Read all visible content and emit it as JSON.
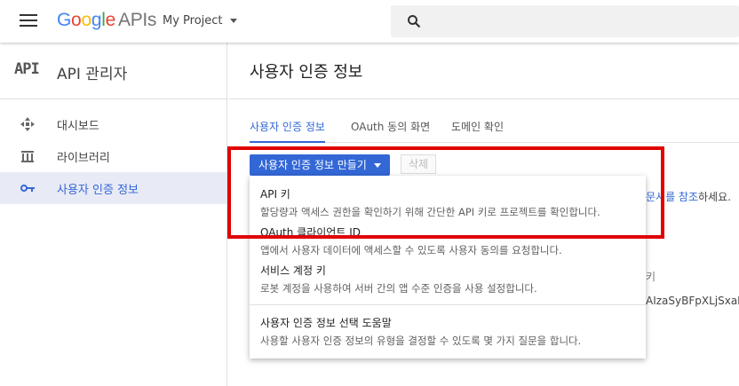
{
  "header": {
    "logo_letters": [
      "G",
      "o",
      "o",
      "g",
      "l",
      "e"
    ],
    "logo_suffix": "APIs",
    "project": "My Project",
    "colors": {
      "blue": "#4285f4",
      "red": "#ea4335",
      "yellow": "#fbbc05",
      "green": "#34a853"
    }
  },
  "sidebar": {
    "brand_mark": "API",
    "title": "API 관리자",
    "items": [
      {
        "label": "대시보드",
        "icon": "dashboard-icon",
        "active": false
      },
      {
        "label": "라이브러리",
        "icon": "library-icon",
        "active": false
      },
      {
        "label": "사용자 인증 정보",
        "icon": "key-icon",
        "active": true
      }
    ]
  },
  "main": {
    "title": "사용자 인증 정보",
    "tabs": [
      {
        "label": "사용자 인증 정보",
        "active": true
      },
      {
        "label": "OAuth 동의 화면",
        "active": false
      },
      {
        "label": "도메인 확인",
        "active": false
      }
    ],
    "create_button": "사용자 인증 정보 만들기",
    "delete_button": "삭제",
    "background": {
      "doc_link": "문서를 참조",
      "doc_suffix": "하세요.",
      "key_column_fragment": "키",
      "key_value_fragment": "AIzaSyBFpXLjSxaMC"
    }
  },
  "menu": {
    "items": [
      {
        "title": "API 키",
        "desc": "할당량과 액세스 권한을 확인하기 위해 간단한 API 키로 프로젝트를 확인합니다."
      },
      {
        "title": "OAuth 클라이언트 ID",
        "desc": "앱에서 사용자 데이터에 액세스할 수 있도록 사용자 동의를 요청합니다."
      },
      {
        "title": "서비스 계정 키",
        "desc": "로봇 계정을 사용하여 서버 간의 앱 수준 인증을 사용 설정합니다."
      },
      {
        "title": "사용자 인증 정보 선택 도움말",
        "desc": "사용할 사용자 인증 정보의 유형을 결정할 수 있도록 몇 가지 질문을 합니다."
      }
    ]
  },
  "annotation": {
    "highlight_color": "#e00000"
  }
}
